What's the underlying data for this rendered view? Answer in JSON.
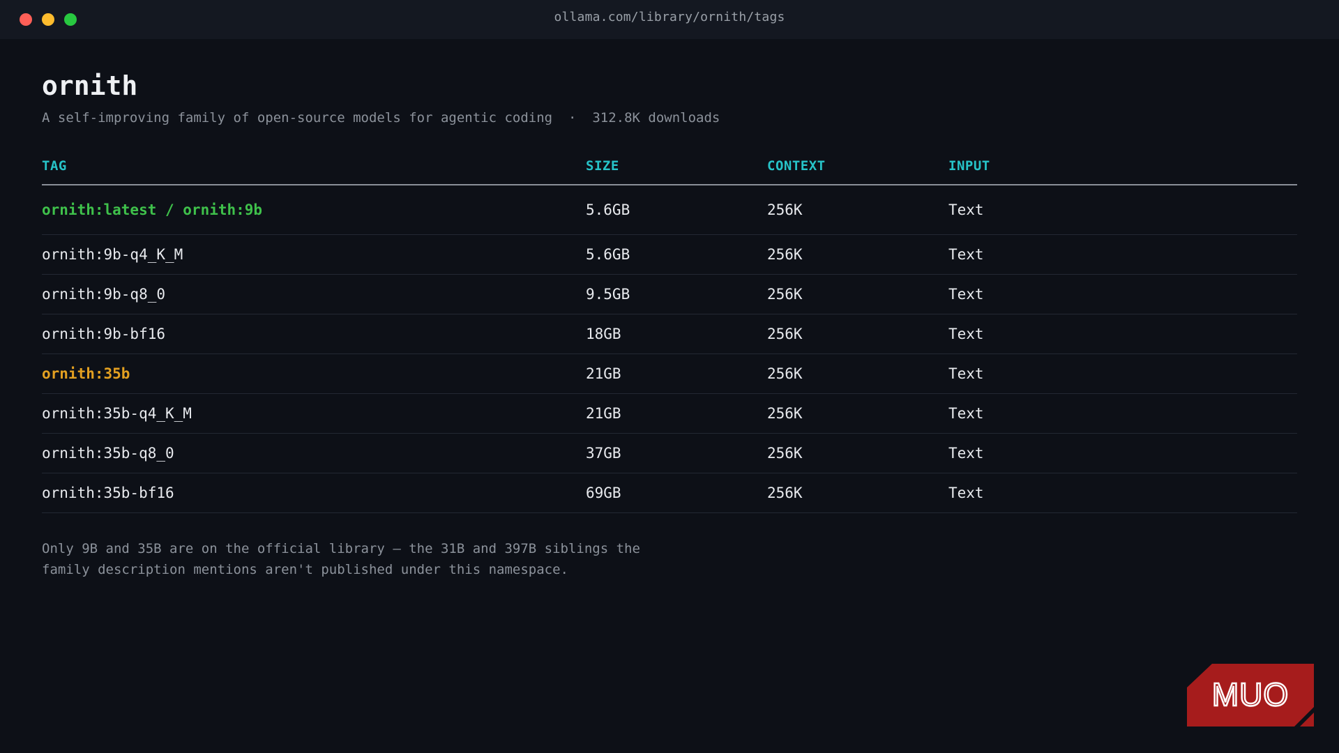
{
  "browser": {
    "url": "ollama.com/library/ornith/tags"
  },
  "page": {
    "title": "ornith",
    "description": "A self-improving family of open-source models for agentic coding",
    "separator": "·",
    "downloads": "312.8K downloads"
  },
  "table": {
    "headers": {
      "tag": "TAG",
      "size": "SIZE",
      "context": "CONTEXT",
      "input": "INPUT"
    },
    "rows": [
      {
        "tag": "ornith:latest / ornith:9b",
        "size": "5.6GB",
        "context": "256K",
        "input": "Text",
        "highlight": "green"
      },
      {
        "tag": "ornith:9b-q4_K_M",
        "size": "5.6GB",
        "context": "256K",
        "input": "Text",
        "highlight": ""
      },
      {
        "tag": "ornith:9b-q8_0",
        "size": "9.5GB",
        "context": "256K",
        "input": "Text",
        "highlight": ""
      },
      {
        "tag": "ornith:9b-bf16",
        "size": "18GB",
        "context": "256K",
        "input": "Text",
        "highlight": ""
      },
      {
        "tag": "ornith:35b",
        "size": "21GB",
        "context": "256K",
        "input": "Text",
        "highlight": "amber"
      },
      {
        "tag": "ornith:35b-q4_K_M",
        "size": "21GB",
        "context": "256K",
        "input": "Text",
        "highlight": ""
      },
      {
        "tag": "ornith:35b-q8_0",
        "size": "37GB",
        "context": "256K",
        "input": "Text",
        "highlight": ""
      },
      {
        "tag": "ornith:35b-bf16",
        "size": "69GB",
        "context": "256K",
        "input": "Text",
        "highlight": ""
      }
    ]
  },
  "note": {
    "line1": "Only 9B and 35B are on the official library — the 31B and 397B siblings the",
    "line2": "family description mentions aren't published under this namespace."
  },
  "watermark": {
    "text": "MUO",
    "icon": "muo-logo"
  },
  "colors": {
    "accent_header": "#27c3c8",
    "highlight_green": "#3fc14b",
    "highlight_amber": "#e3a021",
    "background": "#0d1017",
    "logo_red": "#a61c1c"
  }
}
